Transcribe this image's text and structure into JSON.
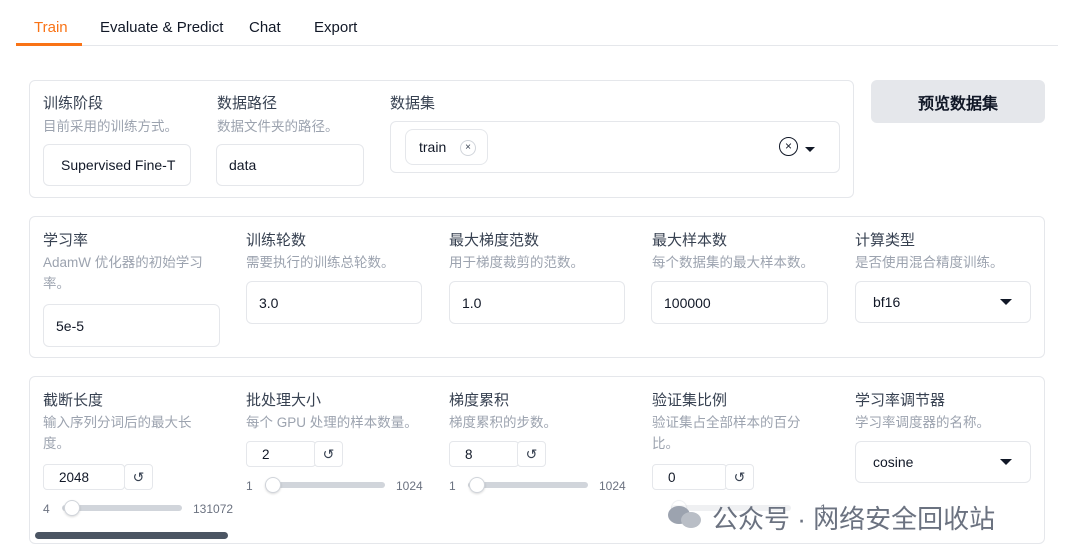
{
  "tabs": [
    {
      "label": "Train",
      "active": true
    },
    {
      "label": "Evaluate & Predict",
      "active": false
    },
    {
      "label": "Chat",
      "active": false
    },
    {
      "label": "Export",
      "active": false
    }
  ],
  "row1": {
    "stage": {
      "label": "训练阶段",
      "info": "目前采用的训练方式。",
      "value": "Supervised Fine-T"
    },
    "dataset_dir": {
      "label": "数据路径",
      "info": "数据文件夹的路径。",
      "value": "data"
    },
    "dataset": {
      "label": "数据集",
      "selected": [
        "train"
      ],
      "remove_glyph": "×",
      "clear_glyph": "×"
    },
    "preview_button": "预览数据集"
  },
  "row2": {
    "learning_rate": {
      "label": "学习率",
      "info": "AdamW 优化器的初始学习率。",
      "value": "5e-5"
    },
    "num_epochs": {
      "label": "训练轮数",
      "info": "需要执行的训练总轮数。",
      "value": "3.0"
    },
    "max_grad_norm": {
      "label": "最大梯度范数",
      "info": "用于梯度裁剪的范数。",
      "value": "1.0"
    },
    "max_samples": {
      "label": "最大样本数",
      "info": "每个数据集的最大样本数。",
      "value": "100000"
    },
    "compute_type": {
      "label": "计算类型",
      "info": "是否使用混合精度训练。",
      "value": "bf16"
    }
  },
  "row3": {
    "cutoff_len": {
      "label": "截断长度",
      "info": "输入序列分词后的最大长度。",
      "value": "2048",
      "min": "4",
      "max": "131072",
      "fraction": 0.016
    },
    "batch_size": {
      "label": "批处理大小",
      "info": "每个 GPU 处理的样本数量。",
      "value": "2",
      "min": "1",
      "max": "1024",
      "fraction": 0.001
    },
    "grad_accum": {
      "label": "梯度累积",
      "info": "梯度累积的步数。",
      "value": "8",
      "min": "1",
      "max": "1024",
      "fraction": 0.007
    },
    "val_size": {
      "label": "验证集比例",
      "info": "验证集占全部样本的百分比。",
      "value": "0",
      "max": "1",
      "fraction": 0
    },
    "lr_scheduler": {
      "label": "学习率调节器",
      "info": "学习率调度器的名称。",
      "value": "cosine"
    }
  },
  "icons": {
    "reset": "↺"
  },
  "watermark": "公众号 · 网络安全回收站",
  "colors": {
    "accent": "#f97316",
    "button_bg": "#e5e7eb",
    "border": "#e5e7eb",
    "muted_text": "#9ca3af"
  }
}
